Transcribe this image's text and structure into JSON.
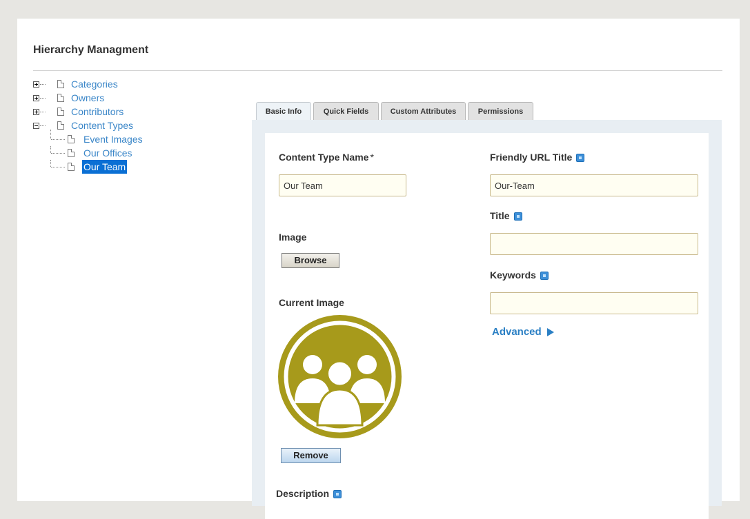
{
  "page_title": "Hierarchy Managment",
  "tree": {
    "items": [
      {
        "label": "Categories"
      },
      {
        "label": "Owners"
      },
      {
        "label": "Contributors"
      },
      {
        "label": "Content Types"
      },
      {
        "label": "Event Images"
      },
      {
        "label": "Our Offices"
      },
      {
        "label": "Our Team"
      }
    ],
    "selected": "Our Team"
  },
  "tabs": [
    {
      "label": "Basic Info",
      "active": true
    },
    {
      "label": "Quick Fields",
      "active": false
    },
    {
      "label": "Custom Attributes",
      "active": false
    },
    {
      "label": "Permissions",
      "active": false
    }
  ],
  "form": {
    "content_type_name_label": "Content Type Name",
    "required_marker": "*",
    "content_type_name_value": "Our Team",
    "image_label": "Image",
    "browse_label": "Browse",
    "current_image_label": "Current Image",
    "remove_label": "Remove",
    "description_label": "Description",
    "friendly_url_label": "Friendly URL Title",
    "friendly_url_value": "Our-Team",
    "title_label": "Title",
    "title_value": "",
    "keywords_label": "Keywords",
    "keywords_value": "",
    "advanced_label": "Advanced"
  },
  "colors": {
    "image_olive": "#a79a1b",
    "link_blue": "#3a86c8",
    "selection_blue": "#0a6fd4"
  },
  "icons": [
    "expand-icon",
    "collapse-icon",
    "document-icon",
    "info-icon",
    "team-image",
    "arrow-right-icon"
  ]
}
